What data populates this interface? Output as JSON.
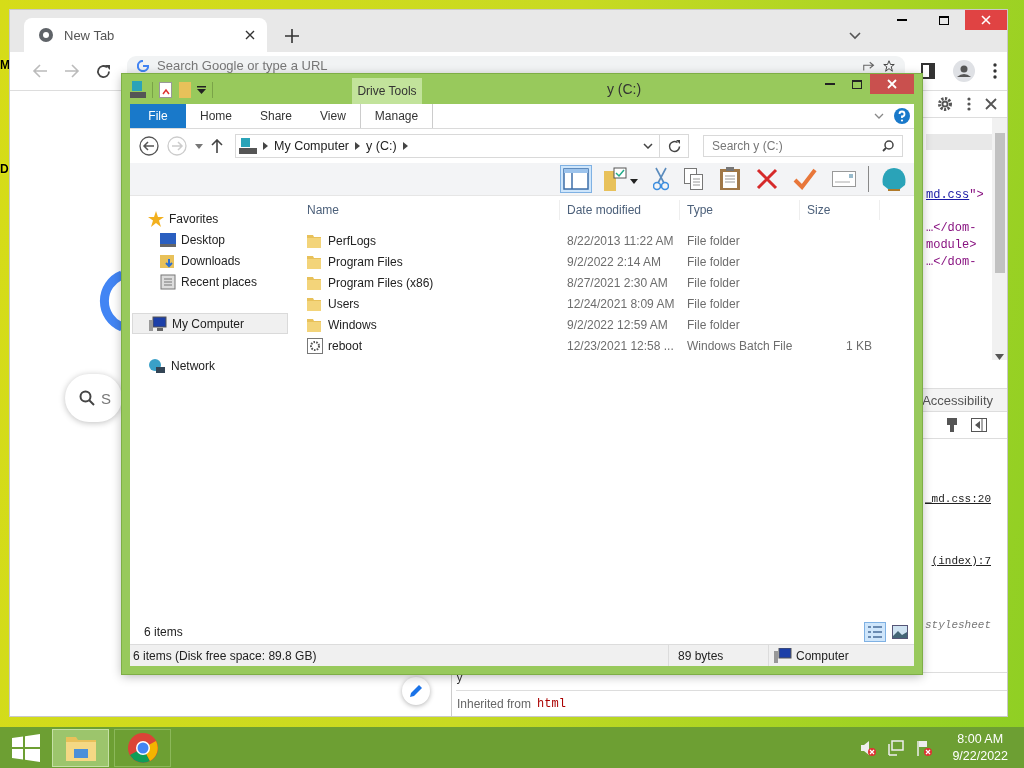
{
  "desktop": {
    "icon_labels": [
      "M",
      "D"
    ]
  },
  "browser": {
    "tabs": [
      {
        "label": "New Tab",
        "selected": true
      }
    ],
    "omnibox": {
      "placeholder": "Search Google or type a URL"
    },
    "page_search": {
      "placeholder": "S"
    },
    "devtools": {
      "code_lines": [
        {
          "link": "md.css",
          "rest": "\">"
        },
        {
          "rest": "…</dom-"
        },
        {
          "rest": "module>"
        },
        {
          "rest": "…</dom-"
        }
      ],
      "tab": "Accessibility",
      "source_links": [
        "_md.css:20",
        "(index):7"
      ],
      "origin_label": "stylesheet",
      "partial_line": "y",
      "inherited": {
        "prefix": "Inherited from",
        "tag": "html"
      }
    }
  },
  "explorer": {
    "title": "y (C:)",
    "contextual_group": "Drive Tools",
    "ribbon_tabs": [
      {
        "label": "File",
        "kind": "file"
      },
      {
        "label": "Home",
        "kind": "normal"
      },
      {
        "label": "Share",
        "kind": "normal"
      },
      {
        "label": "View",
        "kind": "normal"
      },
      {
        "label": "Manage",
        "kind": "contextual"
      }
    ],
    "breadcrumb": [
      "My Computer",
      "y (C:)"
    ],
    "search": {
      "placeholder": "Search y (C:)"
    },
    "toolbar": [
      {
        "kind": "pane",
        "selected": true
      },
      {
        "kind": "folder-check",
        "selected": false
      },
      {
        "kind": "cut",
        "selected": false
      },
      {
        "kind": "copy",
        "selected": false
      },
      {
        "kind": "paste",
        "selected": false
      },
      {
        "kind": "delete",
        "selected": false
      },
      {
        "kind": "check",
        "selected": false
      },
      {
        "kind": "card",
        "selected": false
      },
      {
        "kind": "shell",
        "selected": false
      }
    ],
    "nav": [
      {
        "label": "Favorites",
        "kind": "favorites",
        "selected": false,
        "children": [
          {
            "label": "Desktop",
            "kind": "desktop",
            "selected": false
          },
          {
            "label": "Downloads",
            "kind": "downloads",
            "selected": false
          },
          {
            "label": "Recent places",
            "kind": "recent",
            "selected": false
          }
        ]
      },
      {
        "label": "My Computer",
        "kind": "computer",
        "selected": true
      },
      {
        "label": "Network",
        "kind": "network",
        "selected": false
      }
    ],
    "columns": [
      "Name",
      "Date modified",
      "Type",
      "Size"
    ],
    "rows": [
      {
        "kind": "folder",
        "name": "PerfLogs",
        "date": "8/22/2013 11:22 AM",
        "type": "File folder"
      },
      {
        "kind": "folder",
        "name": "Program Files",
        "date": "9/2/2022 2:14 AM",
        "type": "File folder"
      },
      {
        "kind": "folder",
        "name": "Program Files (x86)",
        "date": "8/27/2021 2:30 AM",
        "type": "File folder"
      },
      {
        "kind": "folder",
        "name": "Users",
        "date": "12/24/2021 8:09 AM",
        "type": "File folder"
      },
      {
        "kind": "folder",
        "name": "Windows",
        "date": "9/2/2022 12:59 AM",
        "type": "File folder"
      },
      {
        "kind": "batch",
        "name": "reboot",
        "date": "12/23/2021 12:58 ...",
        "type": "Windows Batch File",
        "size": "1 KB"
      }
    ],
    "item_count": "6 items",
    "view_buttons": [
      {
        "kind": "details",
        "selected": true
      },
      {
        "kind": "tiles",
        "selected": false
      }
    ],
    "status_bar": {
      "summary": "6 items (Disk free space: 89.8 GB)",
      "size": "89 bytes",
      "location": "Computer"
    }
  },
  "taskbar": {
    "apps": [
      {
        "kind": "explorer",
        "selected": true
      },
      {
        "kind": "chrome",
        "selected": false
      }
    ],
    "time": "8:00 AM",
    "date": "9/22/2022"
  }
}
